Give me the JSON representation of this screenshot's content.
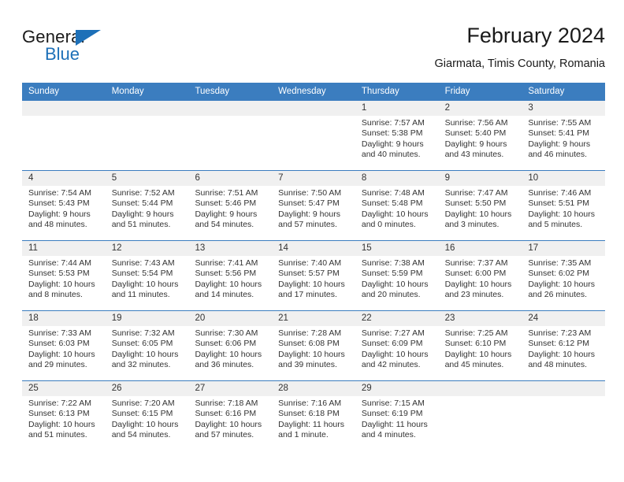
{
  "logo": {
    "word_top": "General",
    "word_bottom": "Blue",
    "triangle_color": "#1d70b8",
    "text_color": "#1a1a1a"
  },
  "header": {
    "title": "February 2024",
    "subtitle": "Giarmata, Timis County, Romania"
  },
  "theme": {
    "header_blue": "#3b7dbf",
    "date_band": "#f0f0f0",
    "text": "#333333"
  },
  "weekday_headers": [
    "Sunday",
    "Monday",
    "Tuesday",
    "Wednesday",
    "Thursday",
    "Friday",
    "Saturday"
  ],
  "weeks": [
    {
      "days": [
        {
          "date": "",
          "sunrise": "",
          "sunset": "",
          "daylight_line1": "",
          "daylight_line2": ""
        },
        {
          "date": "",
          "sunrise": "",
          "sunset": "",
          "daylight_line1": "",
          "daylight_line2": ""
        },
        {
          "date": "",
          "sunrise": "",
          "sunset": "",
          "daylight_line1": "",
          "daylight_line2": ""
        },
        {
          "date": "",
          "sunrise": "",
          "sunset": "",
          "daylight_line1": "",
          "daylight_line2": ""
        },
        {
          "date": "1",
          "sunrise": "Sunrise: 7:57 AM",
          "sunset": "Sunset: 5:38 PM",
          "daylight_line1": "Daylight: 9 hours",
          "daylight_line2": "and 40 minutes."
        },
        {
          "date": "2",
          "sunrise": "Sunrise: 7:56 AM",
          "sunset": "Sunset: 5:40 PM",
          "daylight_line1": "Daylight: 9 hours",
          "daylight_line2": "and 43 minutes."
        },
        {
          "date": "3",
          "sunrise": "Sunrise: 7:55 AM",
          "sunset": "Sunset: 5:41 PM",
          "daylight_line1": "Daylight: 9 hours",
          "daylight_line2": "and 46 minutes."
        }
      ]
    },
    {
      "days": [
        {
          "date": "4",
          "sunrise": "Sunrise: 7:54 AM",
          "sunset": "Sunset: 5:43 PM",
          "daylight_line1": "Daylight: 9 hours",
          "daylight_line2": "and 48 minutes."
        },
        {
          "date": "5",
          "sunrise": "Sunrise: 7:52 AM",
          "sunset": "Sunset: 5:44 PM",
          "daylight_line1": "Daylight: 9 hours",
          "daylight_line2": "and 51 minutes."
        },
        {
          "date": "6",
          "sunrise": "Sunrise: 7:51 AM",
          "sunset": "Sunset: 5:46 PM",
          "daylight_line1": "Daylight: 9 hours",
          "daylight_line2": "and 54 minutes."
        },
        {
          "date": "7",
          "sunrise": "Sunrise: 7:50 AM",
          "sunset": "Sunset: 5:47 PM",
          "daylight_line1": "Daylight: 9 hours",
          "daylight_line2": "and 57 minutes."
        },
        {
          "date": "8",
          "sunrise": "Sunrise: 7:48 AM",
          "sunset": "Sunset: 5:48 PM",
          "daylight_line1": "Daylight: 10 hours",
          "daylight_line2": "and 0 minutes."
        },
        {
          "date": "9",
          "sunrise": "Sunrise: 7:47 AM",
          "sunset": "Sunset: 5:50 PM",
          "daylight_line1": "Daylight: 10 hours",
          "daylight_line2": "and 3 minutes."
        },
        {
          "date": "10",
          "sunrise": "Sunrise: 7:46 AM",
          "sunset": "Sunset: 5:51 PM",
          "daylight_line1": "Daylight: 10 hours",
          "daylight_line2": "and 5 minutes."
        }
      ]
    },
    {
      "days": [
        {
          "date": "11",
          "sunrise": "Sunrise: 7:44 AM",
          "sunset": "Sunset: 5:53 PM",
          "daylight_line1": "Daylight: 10 hours",
          "daylight_line2": "and 8 minutes."
        },
        {
          "date": "12",
          "sunrise": "Sunrise: 7:43 AM",
          "sunset": "Sunset: 5:54 PM",
          "daylight_line1": "Daylight: 10 hours",
          "daylight_line2": "and 11 minutes."
        },
        {
          "date": "13",
          "sunrise": "Sunrise: 7:41 AM",
          "sunset": "Sunset: 5:56 PM",
          "daylight_line1": "Daylight: 10 hours",
          "daylight_line2": "and 14 minutes."
        },
        {
          "date": "14",
          "sunrise": "Sunrise: 7:40 AM",
          "sunset": "Sunset: 5:57 PM",
          "daylight_line1": "Daylight: 10 hours",
          "daylight_line2": "and 17 minutes."
        },
        {
          "date": "15",
          "sunrise": "Sunrise: 7:38 AM",
          "sunset": "Sunset: 5:59 PM",
          "daylight_line1": "Daylight: 10 hours",
          "daylight_line2": "and 20 minutes."
        },
        {
          "date": "16",
          "sunrise": "Sunrise: 7:37 AM",
          "sunset": "Sunset: 6:00 PM",
          "daylight_line1": "Daylight: 10 hours",
          "daylight_line2": "and 23 minutes."
        },
        {
          "date": "17",
          "sunrise": "Sunrise: 7:35 AM",
          "sunset": "Sunset: 6:02 PM",
          "daylight_line1": "Daylight: 10 hours",
          "daylight_line2": "and 26 minutes."
        }
      ]
    },
    {
      "days": [
        {
          "date": "18",
          "sunrise": "Sunrise: 7:33 AM",
          "sunset": "Sunset: 6:03 PM",
          "daylight_line1": "Daylight: 10 hours",
          "daylight_line2": "and 29 minutes."
        },
        {
          "date": "19",
          "sunrise": "Sunrise: 7:32 AM",
          "sunset": "Sunset: 6:05 PM",
          "daylight_line1": "Daylight: 10 hours",
          "daylight_line2": "and 32 minutes."
        },
        {
          "date": "20",
          "sunrise": "Sunrise: 7:30 AM",
          "sunset": "Sunset: 6:06 PM",
          "daylight_line1": "Daylight: 10 hours",
          "daylight_line2": "and 36 minutes."
        },
        {
          "date": "21",
          "sunrise": "Sunrise: 7:28 AM",
          "sunset": "Sunset: 6:08 PM",
          "daylight_line1": "Daylight: 10 hours",
          "daylight_line2": "and 39 minutes."
        },
        {
          "date": "22",
          "sunrise": "Sunrise: 7:27 AM",
          "sunset": "Sunset: 6:09 PM",
          "daylight_line1": "Daylight: 10 hours",
          "daylight_line2": "and 42 minutes."
        },
        {
          "date": "23",
          "sunrise": "Sunrise: 7:25 AM",
          "sunset": "Sunset: 6:10 PM",
          "daylight_line1": "Daylight: 10 hours",
          "daylight_line2": "and 45 minutes."
        },
        {
          "date": "24",
          "sunrise": "Sunrise: 7:23 AM",
          "sunset": "Sunset: 6:12 PM",
          "daylight_line1": "Daylight: 10 hours",
          "daylight_line2": "and 48 minutes."
        }
      ]
    },
    {
      "days": [
        {
          "date": "25",
          "sunrise": "Sunrise: 7:22 AM",
          "sunset": "Sunset: 6:13 PM",
          "daylight_line1": "Daylight: 10 hours",
          "daylight_line2": "and 51 minutes."
        },
        {
          "date": "26",
          "sunrise": "Sunrise: 7:20 AM",
          "sunset": "Sunset: 6:15 PM",
          "daylight_line1": "Daylight: 10 hours",
          "daylight_line2": "and 54 minutes."
        },
        {
          "date": "27",
          "sunrise": "Sunrise: 7:18 AM",
          "sunset": "Sunset: 6:16 PM",
          "daylight_line1": "Daylight: 10 hours",
          "daylight_line2": "and 57 minutes."
        },
        {
          "date": "28",
          "sunrise": "Sunrise: 7:16 AM",
          "sunset": "Sunset: 6:18 PM",
          "daylight_line1": "Daylight: 11 hours",
          "daylight_line2": "and 1 minute."
        },
        {
          "date": "29",
          "sunrise": "Sunrise: 7:15 AM",
          "sunset": "Sunset: 6:19 PM",
          "daylight_line1": "Daylight: 11 hours",
          "daylight_line2": "and 4 minutes."
        },
        {
          "date": "",
          "sunrise": "",
          "sunset": "",
          "daylight_line1": "",
          "daylight_line2": ""
        },
        {
          "date": "",
          "sunrise": "",
          "sunset": "",
          "daylight_line1": "",
          "daylight_line2": ""
        }
      ]
    }
  ]
}
